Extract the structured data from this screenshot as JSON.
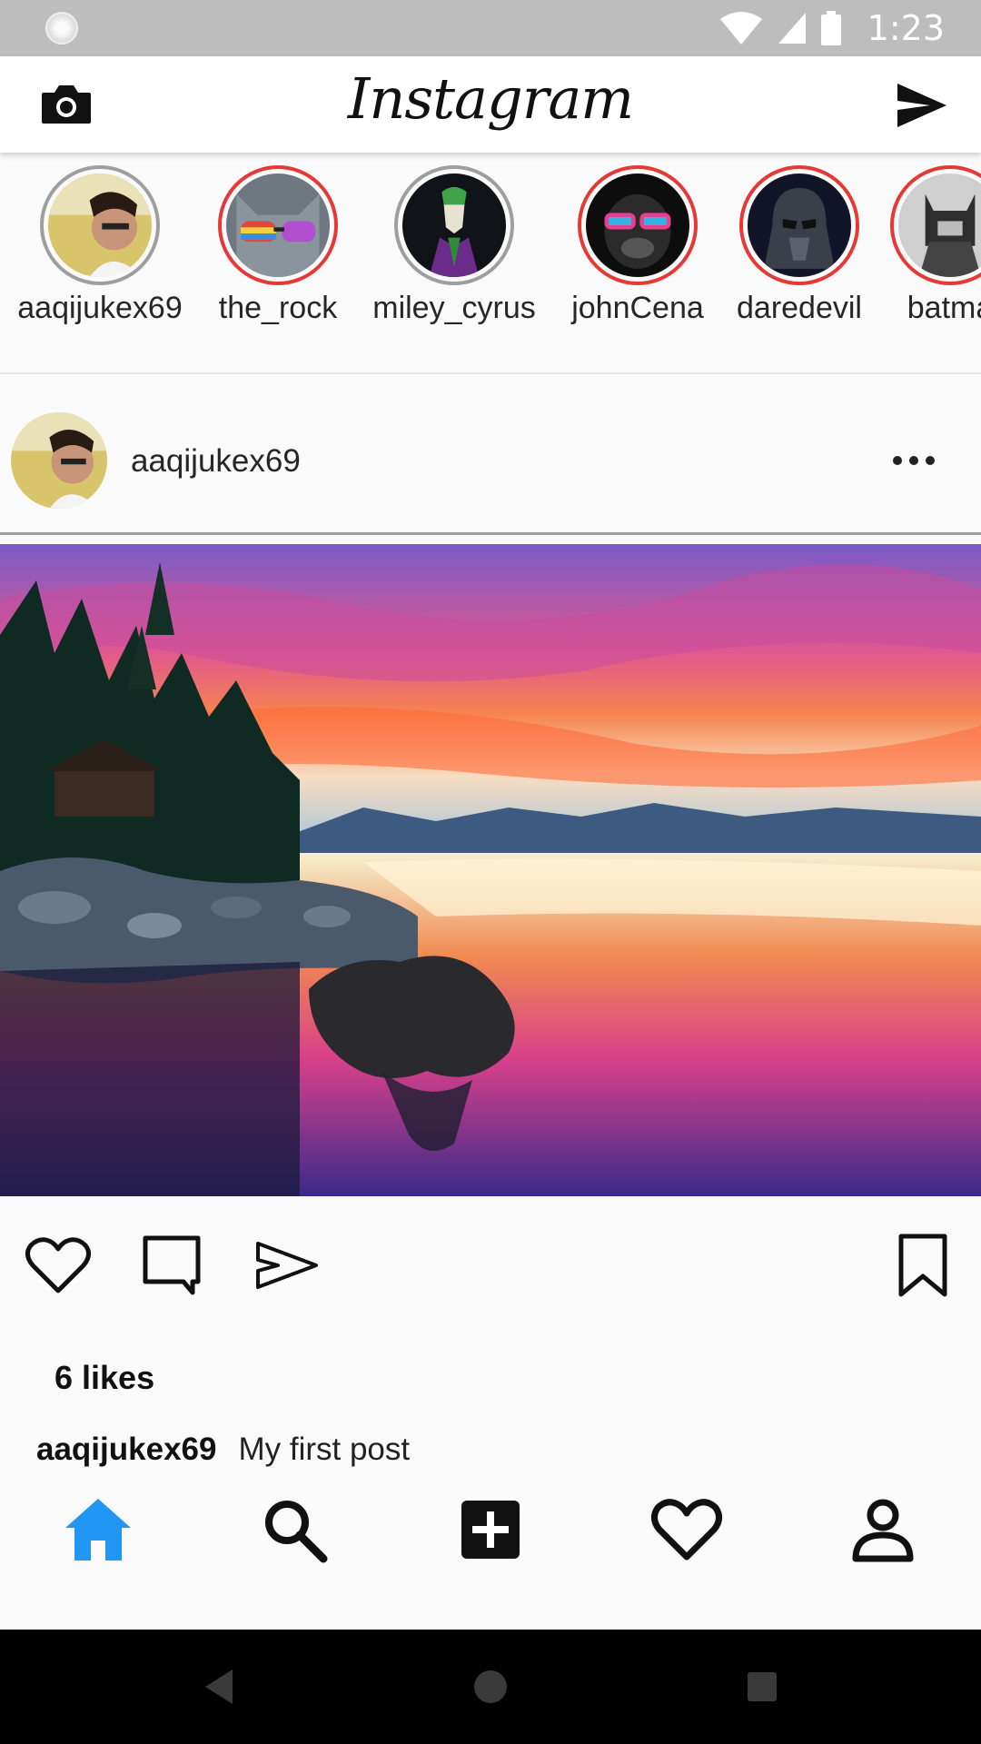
{
  "status_bar": {
    "time": "1:23",
    "icons": [
      "sync-icon",
      "wifi-icon",
      "cell-signal-icon",
      "battery-icon"
    ]
  },
  "header": {
    "logo": "Instagram",
    "left_icon": "camera-icon",
    "right_icon": "send-icon"
  },
  "stories": [
    {
      "username": "aaqijukex69",
      "ring": "seen"
    },
    {
      "username": "the_rock",
      "ring": "new"
    },
    {
      "username": "miley_cyrus",
      "ring": "seen"
    },
    {
      "username": "johnCena",
      "ring": "new"
    },
    {
      "username": "daredevil",
      "ring": "new"
    },
    {
      "username": "batma",
      "ring": "new"
    }
  ],
  "post": {
    "username": "aaqijukex69",
    "likes": "6 likes",
    "caption_user": "aaqijukex69",
    "caption_text": "My first post",
    "actions": [
      "like-icon",
      "comment-icon",
      "share-icon",
      "bookmark-icon"
    ]
  },
  "bottom_nav": {
    "items": [
      "home-icon",
      "search-icon",
      "add-post-icon",
      "activity-heart-icon",
      "profile-icon"
    ],
    "active": "home-icon",
    "active_color": "#2196f3"
  },
  "system_nav": [
    "back-icon",
    "home-circle-icon",
    "recents-icon"
  ],
  "colors": {
    "status_bar": "#bdbdbd",
    "story_ring_new": "#e53935",
    "story_ring_seen": "#9e9e9e",
    "background": "#fafafa"
  }
}
